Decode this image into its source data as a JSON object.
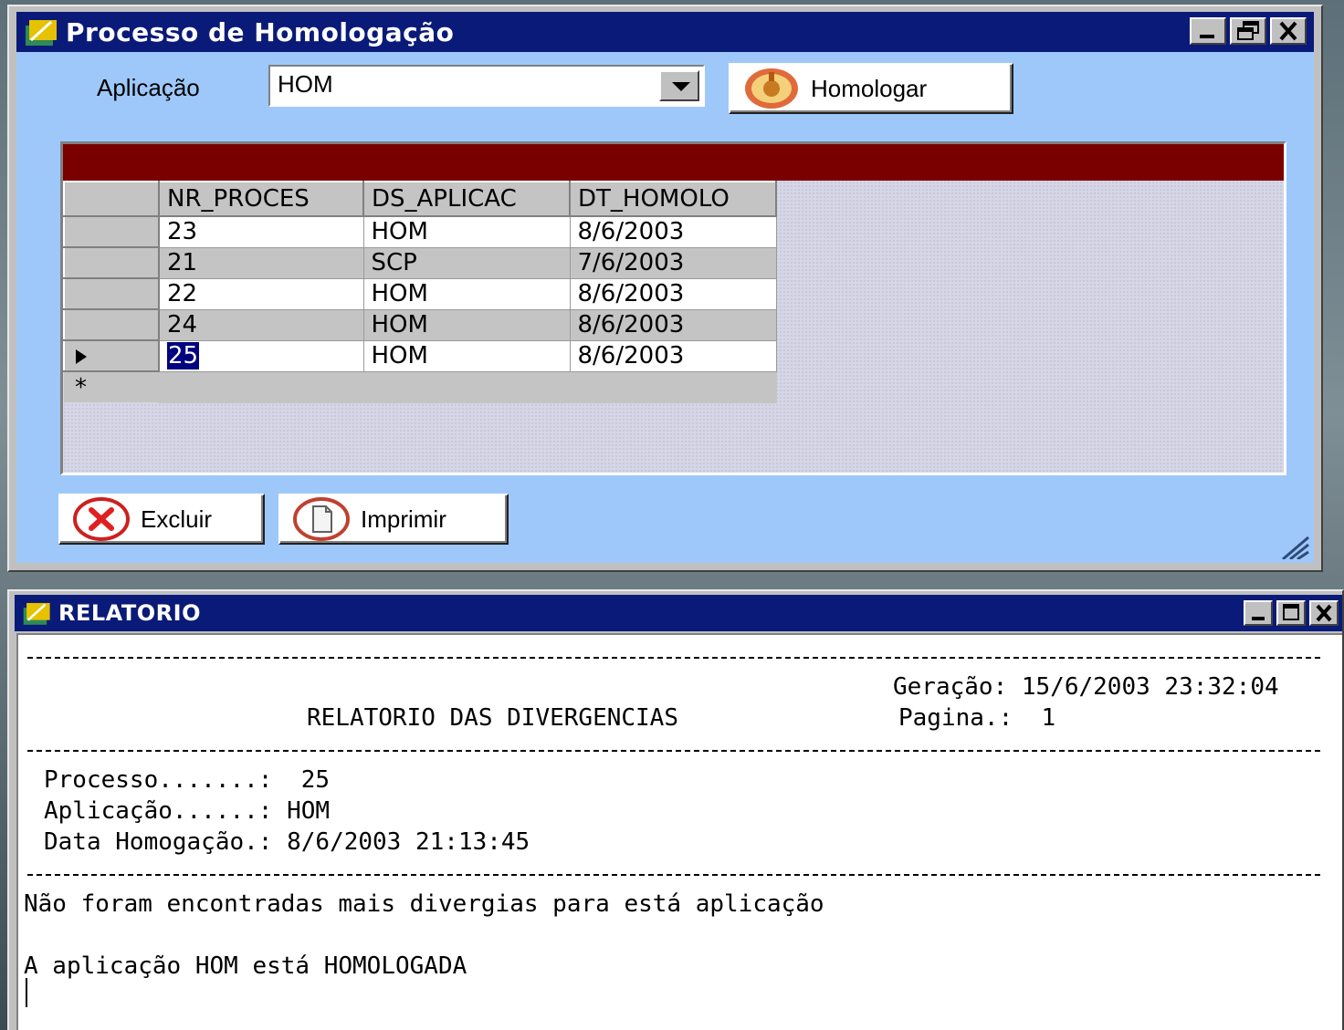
{
  "window1": {
    "title": "Processo de Homologação",
    "aplicacao_label": "Aplicação",
    "aplicacao_value": "HOM",
    "homologar_label": "Homologar",
    "grid": {
      "columns": [
        "NR_PROCES",
        "DS_APLICAC",
        "DT_HOMOLO"
      ],
      "rows": [
        {
          "nr": "23",
          "ds": "HOM",
          "dt": "8/6/2003"
        },
        {
          "nr": "21",
          "ds": "SCP",
          "dt": "7/6/2003"
        },
        {
          "nr": "22",
          "ds": "HOM",
          "dt": "8/6/2003"
        },
        {
          "nr": "24",
          "ds": "HOM",
          "dt": "8/6/2003"
        },
        {
          "nr": "25",
          "ds": "HOM",
          "dt": "8/6/2003"
        }
      ],
      "new_row_marker": "*"
    },
    "excluir_label": "Excluir",
    "imprimir_label": "Imprimir"
  },
  "window2": {
    "title": "RELATORIO",
    "geracao": "Geração: 15/6/2003 23:32:04",
    "report_title": "RELATORIO DAS DIVERGENCIAS",
    "pagina": "Pagina.:  1",
    "processo": "Processo.......:  25",
    "aplicacao": "Aplicação......: HOM",
    "data_homologacao": "Data Homogação.: 8/6/2003 21:13:45",
    "msg1": "Não foram encontradas mais divergias para está aplicação",
    "msg2": "A aplicação HOM está HOMOLOGADA"
  }
}
